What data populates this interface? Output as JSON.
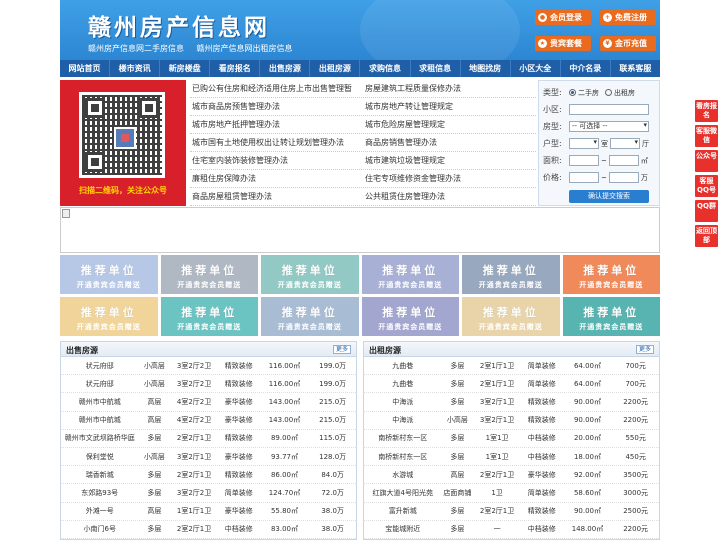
{
  "header": {
    "title": "赣州房产信息网",
    "sub_links": [
      "赣州房产信息网二手房信息",
      "赣州房产信息网出租房信息"
    ],
    "buttons": [
      {
        "icon": "user-icon",
        "label": "会员登录"
      },
      {
        "icon": "register-icon",
        "label": "免费注册"
      },
      {
        "icon": "gift-icon",
        "label": "贵宾套餐"
      },
      {
        "icon": "coin-icon",
        "label": "金币充值"
      }
    ]
  },
  "nav": [
    "网站首页",
    "楼市资讯",
    "新房楼盘",
    "看房报名",
    "出售房源",
    "出租房源",
    "求购信息",
    "求租信息",
    "地图找房",
    "小区大全",
    "中介名录",
    "联系客服"
  ],
  "qr": {
    "caption": "扫描二维码，关注公众号"
  },
  "news": [
    [
      "已购公有住房和经济适用住房上市出售管理暂",
      "房屋建筑工程质量保修办法"
    ],
    [
      "城市商品房预售管理办法",
      "城市房地产转让管理规定"
    ],
    [
      "城市房地产抵押管理办法",
      "城市危险房屋管理规定"
    ],
    [
      "城市国有土地使用权出让转让规划管理办法",
      "商品房销售管理办法"
    ],
    [
      "住宅室内装饰装修管理办法",
      "城市建筑垃圾管理规定"
    ],
    [
      "廉租住房保障办法",
      "住宅专项维修资金管理办法"
    ],
    [
      "商品房屋租赁管理办法",
      "公共租赁住房管理办法"
    ]
  ],
  "search": {
    "type_label": "类型:",
    "opt1": "二手房",
    "opt2": "出租房",
    "area_label": "小区:",
    "room_label": "房型:",
    "room_select": "-- 可选择 --",
    "huxing_label": "户型:",
    "shi": "室",
    "ting": "厅",
    "mianji_label": "面积:",
    "mianji_unit": "㎡",
    "price_label": "价格:",
    "price_unit": "万",
    "tilde": "~",
    "submit": "确认提交搜索"
  },
  "ads": {
    "t1": "推荐单位",
    "t2": "开通贵宾会员赠送",
    "colors": [
      "#b7c7e6",
      "#b0b8c4",
      "#93c9c4",
      "#a9b0d6",
      "#98a8be",
      "#f08a5a",
      "#f0d49a",
      "#6cc4c2",
      "#a8bcd4",
      "#a3a6cf",
      "#e8d4a8",
      "#58b4b0"
    ]
  },
  "sale": {
    "title": "出售房源",
    "more": "更多",
    "rows": [
      [
        "状元府邸",
        "小高层",
        "3室2厅2卫",
        "精致装修",
        "116.00㎡",
        "199.0万"
      ],
      [
        "状元府邸",
        "小高层",
        "3室2厅2卫",
        "精致装修",
        "116.00㎡",
        "199.0万"
      ],
      [
        "赣州市中航城",
        "高层",
        "4室2厅2卫",
        "豪华装修",
        "143.00㎡",
        "215.0万"
      ],
      [
        "赣州市中航城",
        "高层",
        "4室2厅2卫",
        "豪华装修",
        "143.00㎡",
        "215.0万"
      ],
      [
        "赣州市文武坝路桥华庭",
        "多层",
        "2室2厅1卫",
        "精致装修",
        "89.00㎡",
        "115.0万"
      ],
      [
        "保利堂悦",
        "小高层",
        "3室2厅1卫",
        "豪华装修",
        "93.77㎡",
        "128.0万"
      ],
      [
        "瑞香新城",
        "多层",
        "2室2厅1卫",
        "精致装修",
        "86.00㎡",
        "84.0万"
      ],
      [
        "东郊路93号",
        "多层",
        "3室2厅2卫",
        "简单装修",
        "124.70㎡",
        "72.0万"
      ],
      [
        "外滩一号",
        "高层",
        "1室1厅1卫",
        "豪华装修",
        "55.80㎡",
        "38.0万"
      ],
      [
        "小南门6号",
        "多层",
        "2室2厅1卫",
        "中档装修",
        "83.00㎡",
        "38.0万"
      ]
    ]
  },
  "rent": {
    "title": "出租房源",
    "more": "更多",
    "rows": [
      [
        "九曲巷",
        "多层",
        "2室1厅1卫",
        "简单装修",
        "64.00㎡",
        "700元"
      ],
      [
        "九曲巷",
        "多层",
        "2室1厅1卫",
        "简单装修",
        "64.00㎡",
        "700元"
      ],
      [
        "中海派",
        "多层",
        "3室2厅1卫",
        "精致装修",
        "90.00㎡",
        "2200元"
      ],
      [
        "中海派",
        "小高层",
        "3室2厅1卫",
        "精致装修",
        "90.00㎡",
        "2200元"
      ],
      [
        "南桥新村东一区",
        "多层",
        "1室1卫",
        "中档装修",
        "20.00㎡",
        "550元"
      ],
      [
        "南桥新村东一区",
        "多层",
        "1室1卫",
        "中档装修",
        "18.00㎡",
        "450元"
      ],
      [
        "水游城",
        "高层",
        "2室2厅1卫",
        "豪华装修",
        "92.00㎡",
        "3500元"
      ],
      [
        "红旗大道4号阳光苑",
        "店面商铺",
        "1卫",
        "简单装修",
        "58.60㎡",
        "3000元"
      ],
      [
        "富升新城",
        "多层",
        "2室2厅1卫",
        "精致装修",
        "90.00㎡",
        "2500元"
      ],
      [
        "宝能城附近",
        "多层",
        "一",
        "中档装修",
        "148.00㎡",
        "2200元"
      ]
    ]
  },
  "float": [
    "看房报名",
    "客服微信",
    "公众号",
    "客服QQ号",
    "QQ群",
    "返回顶部"
  ]
}
